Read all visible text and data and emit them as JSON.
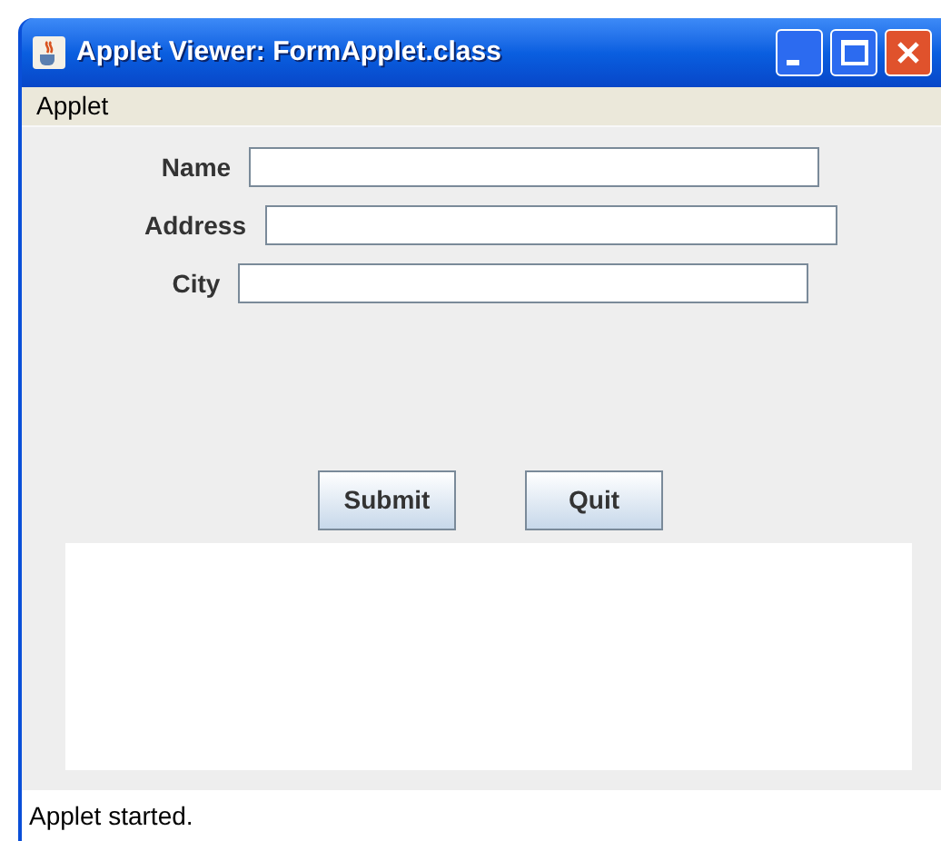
{
  "window": {
    "title": "Applet Viewer: FormApplet.class"
  },
  "menu": [
    "Applet"
  ],
  "fields": [
    {
      "label": "Name"
    },
    {
      "label": "Address"
    },
    {
      "label": "City"
    }
  ],
  "buttons": [
    "Submit",
    "Quit"
  ],
  "status_bar": "Applet started."
}
